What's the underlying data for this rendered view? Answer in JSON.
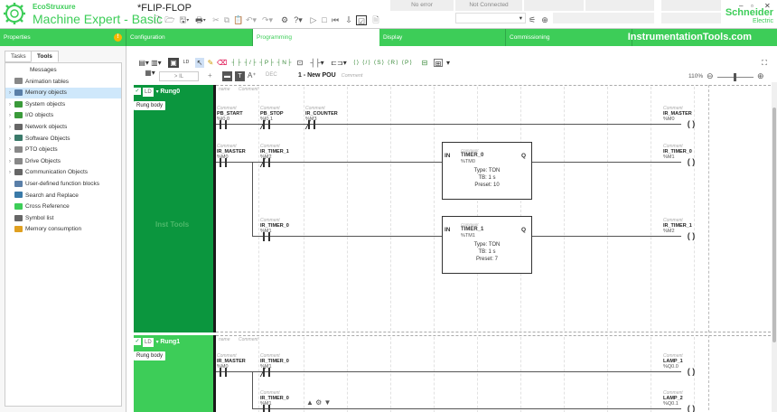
{
  "titlebar": {
    "brand": "EcoStruxure",
    "app_name": "Machine Expert - Basic",
    "project": "*FLIP-FLOP",
    "status_error": "No error",
    "status_connection": "Not Connected",
    "company": "Schneider",
    "company_sub": "Electric",
    "win_min": "–",
    "win_max": "▫",
    "win_close": "✕"
  },
  "main_tabs": {
    "properties": "Properties",
    "configuration": "Configuration",
    "programming": "Programming",
    "display": "Display",
    "commissioning": "Commissioning",
    "watermark": "InstrumentationTools.com"
  },
  "left_panel": {
    "tabs": [
      "Tasks",
      "Tools"
    ],
    "items": [
      {
        "label": "Messages",
        "chev": "",
        "icon": "messages-icon",
        "color": "transparent"
      },
      {
        "label": "Animation tables",
        "chev": "",
        "icon": "animation-table-icon",
        "color": "#888888"
      },
      {
        "label": "Memory objects",
        "chev": "›",
        "icon": "memory-objects-icon",
        "color": "#5a7fa8"
      },
      {
        "label": "System objects",
        "chev": "›",
        "icon": "system-objects-icon",
        "color": "#3a9a3a"
      },
      {
        "label": "I/O objects",
        "chev": "›",
        "icon": "io-objects-icon",
        "color": "#3a9a3a"
      },
      {
        "label": "Network objects",
        "chev": "›",
        "icon": "network-objects-icon",
        "color": "#666666"
      },
      {
        "label": "Software Objects",
        "chev": "›",
        "icon": "software-objects-icon",
        "color": "#3a7a6a"
      },
      {
        "label": "PTO objects",
        "chev": "›",
        "icon": "pto-objects-icon",
        "color": "#888888"
      },
      {
        "label": "Drive Objects",
        "chev": "›",
        "icon": "drive-objects-icon",
        "color": "#888888"
      },
      {
        "label": "Communication Objects",
        "chev": "›",
        "icon": "communication-objects-icon",
        "color": "#666666"
      },
      {
        "label": "User-defined function blocks",
        "chev": "",
        "icon": "user-fb-icon",
        "color": "#5a7fa8"
      },
      {
        "label": "Search and Replace",
        "chev": "",
        "icon": "search-replace-icon",
        "color": "#3a7aa8"
      },
      {
        "label": "Cross Reference",
        "chev": "",
        "icon": "cross-reference-icon",
        "color": "#3dcd58"
      },
      {
        "label": "Symbol list",
        "chev": "",
        "icon": "symbol-list-icon",
        "color": "#666666"
      },
      {
        "label": "Memory consumption",
        "chev": "",
        "icon": "memory-consumption-icon",
        "color": "#e0a020"
      }
    ],
    "selected_index": 2
  },
  "editor": {
    "toolbar_il": "> IL",
    "toolbar_plus": "+",
    "toolbar_dec": "DEC",
    "pou_name": "1 - New POU",
    "pou_comment": "Comment",
    "zoom": "110%",
    "zoom_minus": "⊖",
    "zoom_plus": "⊕",
    "grid_expand": "⛶",
    "toolbar_icons": "▤ ▥ ▦  ▣ LD  ⬚ ╱ ∅  ┤├ ┤/├ ┤P├ ┤N├  ⊡  ─┤├─  ⊏⊐  ()  (/)  (S) (R) (P)  ⊟  ⊞"
  },
  "rungs": [
    {
      "label": "Rung0",
      "lang": "LD",
      "body": "Rung body",
      "name_hint": "name",
      "comment_hint": "Comment",
      "side_text": "Inst Tools",
      "contacts": [
        {
          "comment": "Comment",
          "name": "PB_START",
          "addr": "%I0.0",
          "type": "NO"
        },
        {
          "comment": "Comment",
          "name": "PB_STOP",
          "addr": "%I0.1",
          "type": "NC"
        },
        {
          "comment": "Comment",
          "name": "IR_COUNTER",
          "addr": "%M3",
          "type": "NC"
        },
        {
          "comment": "Comment",
          "name": "IR_MASTER",
          "addr": "%M0",
          "type": "NO"
        },
        {
          "comment": "Comment",
          "name": "IR_TIMER_1",
          "addr": "%M2",
          "type": "NC"
        },
        {
          "comment": "Comment",
          "name": "IR_TIMER_0",
          "addr": "%M1",
          "type": "NO"
        }
      ],
      "coils": [
        {
          "comment": "Comment",
          "name": "IR_MASTER",
          "addr": "%M0"
        },
        {
          "comment": "Comment",
          "name": "IR_TIMER_0",
          "addr": "%M1"
        },
        {
          "comment": "Comment",
          "name": "IR_TIMER_1",
          "addr": "%M2"
        }
      ],
      "blocks": [
        {
          "in": "IN",
          "q": "Q",
          "comment": "Comment",
          "name": "TIMER_0",
          "addr": "%TM0",
          "type": "Type: TON",
          "tb": "TB: 1 s",
          "preset": "Preset: 10"
        },
        {
          "in": "IN",
          "q": "Q",
          "comment": "Comment",
          "name": "TIMER_1",
          "addr": "%TM1",
          "type": "Type: TON",
          "tb": "TB: 1 s",
          "preset": "Preset: 7"
        }
      ]
    },
    {
      "label": "Rung1",
      "lang": "LD",
      "body": "Rung body",
      "name_hint": "name",
      "comment_hint": "Comment",
      "contacts": [
        {
          "comment": "Comment",
          "name": "IR_MASTER",
          "addr": "%M0",
          "type": "NO"
        },
        {
          "comment": "Comment",
          "name": "IR_TIMER_0",
          "addr": "%M1",
          "type": "NC"
        },
        {
          "comment": "Comment",
          "name": "IR_TIMER_0",
          "addr": "%M1",
          "type": "NO"
        }
      ],
      "coils": [
        {
          "comment": "Comment",
          "name": "LAMP_1",
          "addr": "%Q0.0"
        },
        {
          "comment": "Comment",
          "name": "LAMP_2",
          "addr": "%Q0.1"
        }
      ]
    }
  ],
  "colors": {
    "brand_green": "#3dcd58",
    "dark_green": "#0b963e"
  }
}
